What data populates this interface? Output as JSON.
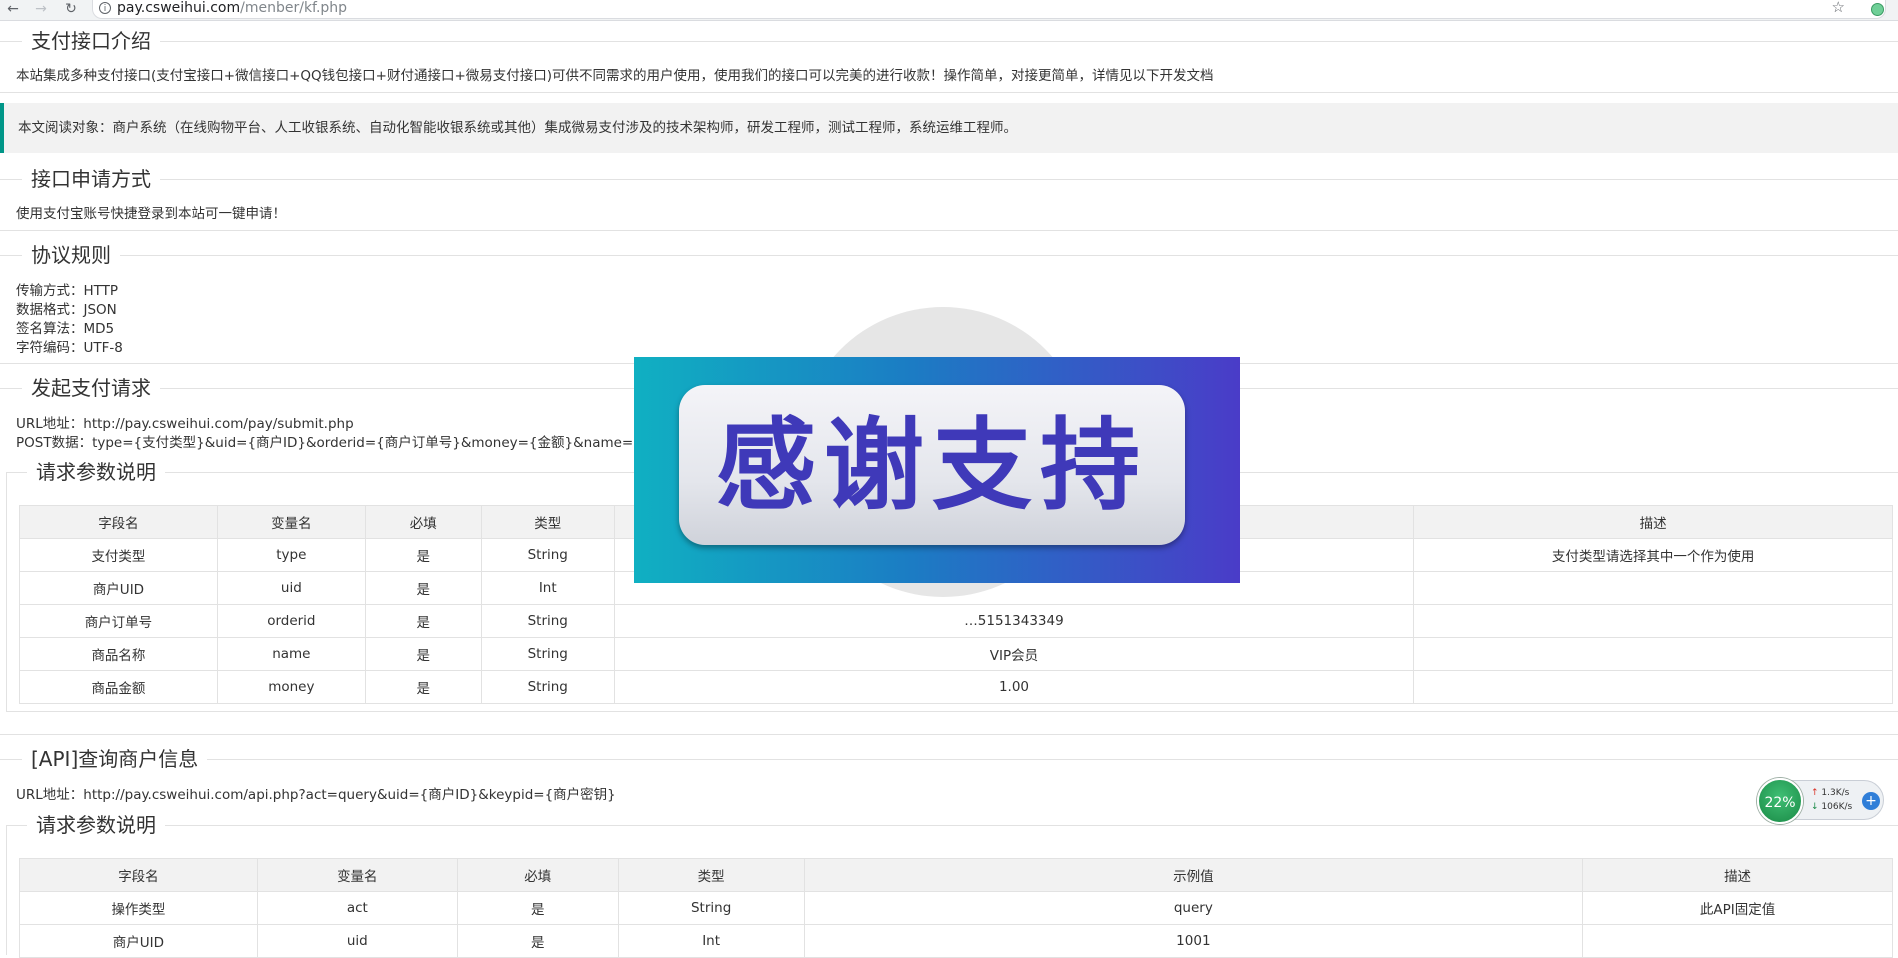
{
  "browser": {
    "url_host": "pay.csweihui.com",
    "url_path": "/menber/kf.php"
  },
  "intro": {
    "title": "支付接口介绍",
    "text": "本站集成多种支付接口(支付宝接口+微信接口+QQ钱包接口+财付通接口+微易支付接口)可供不同需求的用户使用，使用我们的接口可以完美的进行收款！操作简单，对接更简单，详情见以下开发文档"
  },
  "notice": "本文阅读对象：商户系统（在线购物平台、人工收银系统、自动化智能收银系统或其他）集成微易支付涉及的技术架构师，研发工程师，测试工程师，系统运维工程师。",
  "apply": {
    "title": "接口申请方式",
    "text": "使用支付宝账号快捷登录到本站可一键申请！"
  },
  "protocol": {
    "title": "协议规则",
    "lines": [
      "传输方式：HTTP",
      "数据格式：JSON",
      "签名算法：MD5",
      "字符编码：UTF-8"
    ]
  },
  "submit": {
    "title": "发起支付请求",
    "url_line": "URL地址：http://pay.csweihui.com/pay/submit.php",
    "post_line": "POST数据：type={支付类型}&uid={商户ID}&orderid={商户订单号}&money={金额}&name={商品名称",
    "params_title": "请求参数说明",
    "headers": [
      "字段名",
      "变量名",
      "必填",
      "类型",
      "",
      "描述"
    ],
    "rows": [
      [
        "支付类型",
        "type",
        "是",
        "String",
        "",
        "支付类型请选择其中一个作为使用"
      ],
      [
        "商户UID",
        "uid",
        "是",
        "Int",
        "",
        ""
      ],
      [
        "商户订单号",
        "orderid",
        "是",
        "String",
        "…5151343349",
        ""
      ],
      [
        "商品名称",
        "name",
        "是",
        "String",
        "VIP会员",
        ""
      ],
      [
        "商品金额",
        "money",
        "是",
        "String",
        "1.00",
        ""
      ]
    ]
  },
  "query": {
    "title": "[API]查询商户信息",
    "url_line": "URL地址：http://pay.csweihui.com/api.php?act=query&uid={商户ID}&keypid={商户密钥}",
    "params_title": "请求参数说明",
    "headers": [
      "字段名",
      "变量名",
      "必填",
      "类型",
      "示例值",
      "描述"
    ],
    "rows": [
      [
        "操作类型",
        "act",
        "是",
        "String",
        "query",
        "此API固定值"
      ],
      [
        "商户UID",
        "uid",
        "是",
        "Int",
        "1001",
        ""
      ]
    ]
  },
  "overlay": {
    "banner_text": "感谢支持"
  },
  "speed_widget": {
    "percent": "22%",
    "up": "1.3K/s",
    "down": "106K/s"
  }
}
